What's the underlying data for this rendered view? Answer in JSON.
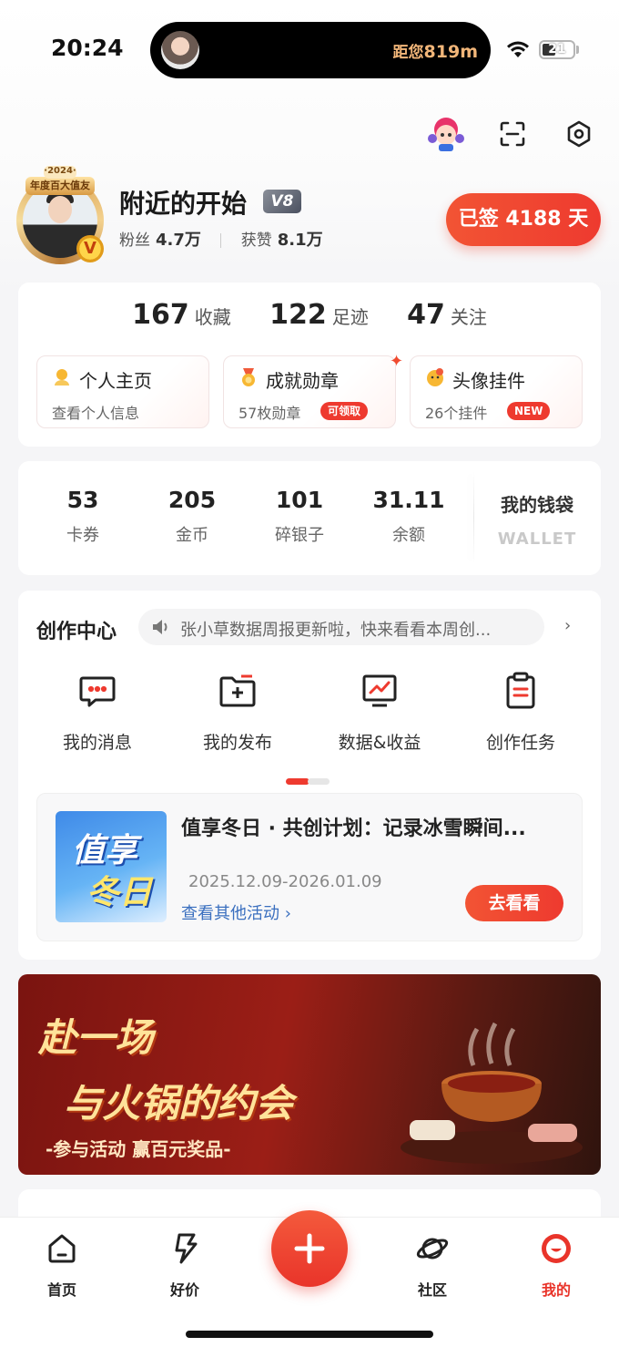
{
  "status_bar": {
    "time": "20:24",
    "island_text_prefix": "距您",
    "island_distance": "819m",
    "battery_level": "21"
  },
  "top_icons": [
    "mascot-icon",
    "scan-icon",
    "settings-icon"
  ],
  "profile": {
    "avatar_year": "·2024·",
    "avatar_banner": "年度百大值友",
    "avatar_badge": "V",
    "username": "附近的开始",
    "level": "V8",
    "fans_label": "粉丝",
    "fans_value": "4.7万",
    "likes_label": "获赞",
    "likes_value": "8.1万",
    "checkin_label": "已签 4188 天"
  },
  "counts": [
    {
      "value": "167",
      "label": "收藏"
    },
    {
      "value": "122",
      "label": "足迹"
    },
    {
      "value": "47",
      "label": "关注"
    }
  ],
  "mini_cards": [
    {
      "title": "个人主页",
      "sub": "查看个人信息",
      "icon": "user-home-icon"
    },
    {
      "title": "成就勋章",
      "sub": "57枚勋章",
      "tag": "可领取",
      "icon": "medal-icon"
    },
    {
      "title": "头像挂件",
      "sub": "26个挂件",
      "tag": "NEW",
      "icon": "avatar-pendant-icon"
    }
  ],
  "assets": [
    {
      "value": "53",
      "label": "卡券"
    },
    {
      "value": "205",
      "label": "金币"
    },
    {
      "value": "101",
      "label": "碎银子"
    },
    {
      "value": "31.11",
      "label": "余额"
    }
  ],
  "wallet": {
    "title": "我的钱袋",
    "subtitle": "WALLET"
  },
  "creator": {
    "title": "创作中心",
    "notice": "张小草数据周报更新啦，快来看看本周创...",
    "arrow": "›",
    "tools": [
      {
        "label": "我的消息",
        "icon": "message-icon"
      },
      {
        "label": "我的发布",
        "icon": "publish-icon"
      },
      {
        "label": "数据&收益",
        "icon": "data-chart-icon"
      },
      {
        "label": "创作任务",
        "icon": "task-clipboard-icon"
      }
    ],
    "activity": {
      "image_text_1": "值享",
      "image_text_2": "冬日",
      "title": "值享冬日 · 共创计划：记录冰雪瞬间...",
      "date": "2025.12.09-2026.01.09",
      "link": "查看其他活动 ›",
      "button": "去看看"
    }
  },
  "banner": {
    "line1": "赴一场",
    "line2": "与火锅的约会",
    "line3": "-参与活动  赢百元奖品-"
  },
  "tabbar": {
    "home": "首页",
    "deals": "好价",
    "community": "社区",
    "mine": "我的",
    "fab": "+"
  },
  "colors": {
    "accent": "#ee3a2f",
    "link": "#3a6fbf",
    "gold": "#ffe39a"
  }
}
